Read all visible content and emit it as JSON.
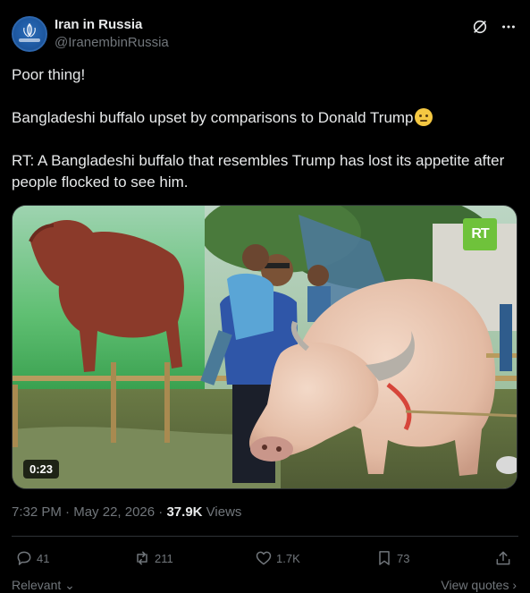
{
  "author": {
    "name": "Iran in Russia",
    "handle": "@IranembinRussia",
    "avatar_icon": "iran-embassy-emblem-icon"
  },
  "header_icons": [
    "grok-icon",
    "more-options-icon"
  ],
  "tweet": {
    "line1": "Poor thing!",
    "line2": "Bangladeshi buffalo upset by comparisons to Donald Trump",
    "line2_emoji": "neutral-face-emoji",
    "line3": "RT: A Bangladeshi buffalo that resembles Trump has lost its appetite after people flocked to see him."
  },
  "media": {
    "type": "video",
    "duration": "0:23",
    "watermark": "RT",
    "watermark_color": "#6fc23b"
  },
  "meta": {
    "time": "7:32 PM",
    "separator1": " · ",
    "date": "May 22, 2026",
    "separator2": " · ",
    "views_count": "37.9K",
    "views_label": " Views"
  },
  "actions": {
    "replies": "41",
    "reposts": "211",
    "likes": "1.7K",
    "bookmarks": "73"
  },
  "footer": {
    "relevant": "Relevant",
    "view_quotes": "View quotes"
  },
  "colors": {
    "background": "#000000",
    "text": "#e7e9ea",
    "secondary": "#71767b",
    "divider": "#2f3336"
  }
}
